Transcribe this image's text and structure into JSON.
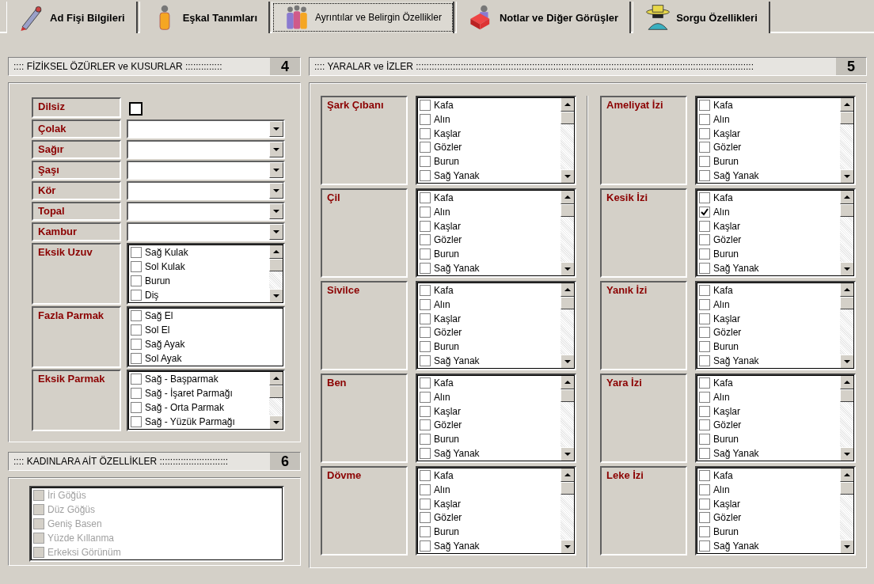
{
  "tabs": [
    {
      "label": "Ad Fişi Bilgileri",
      "selected": false
    },
    {
      "label": "Eşkal Tanımları",
      "selected": false
    },
    {
      "label": "Ayrıntılar ve Belirgin Özellikler",
      "selected": true
    },
    {
      "label": "Notlar ve Diğer Görüşler",
      "selected": false
    },
    {
      "label": "Sorgu  Özellikleri",
      "selected": false
    }
  ],
  "physical": {
    "title": ":::: FİZİKSEL ÖZÜRLER ve KUSURLAR ::::::::::::::",
    "number": "4",
    "rows": [
      {
        "label": "Dilsiz",
        "kind": "checkbox",
        "checked": false
      },
      {
        "label": "Çolak",
        "kind": "dropdown"
      },
      {
        "label": "Sağır",
        "kind": "dropdown"
      },
      {
        "label": "Şaşı",
        "kind": "dropdown"
      },
      {
        "label": "Kör",
        "kind": "dropdown"
      },
      {
        "label": "Topal",
        "kind": "dropdown"
      },
      {
        "label": "Kambur",
        "kind": "dropdown"
      },
      {
        "label": "Eksik Uzuv",
        "kind": "checklist",
        "scrollable": true,
        "items": [
          {
            "label": "Sağ Kulak",
            "checked": false
          },
          {
            "label": "Sol Kulak",
            "checked": false
          },
          {
            "label": "Burun",
            "checked": false
          },
          {
            "label": "Diş",
            "checked": false
          }
        ]
      },
      {
        "label": "Fazla Parmak",
        "kind": "checklist",
        "scrollable": false,
        "items": [
          {
            "label": "Sağ El",
            "checked": false
          },
          {
            "label": "Sol El",
            "checked": false
          },
          {
            "label": "Sağ Ayak",
            "checked": false
          },
          {
            "label": "Sol Ayak",
            "checked": false
          }
        ]
      },
      {
        "label": "Eksik Parmak",
        "kind": "checklist",
        "scrollable": true,
        "items": [
          {
            "label": "Sağ - Başparmak",
            "checked": false
          },
          {
            "label": "Sağ - İşaret Parmağı",
            "checked": false
          },
          {
            "label": "Sağ - Orta Parmak",
            "checked": false
          },
          {
            "label": "Sağ - Yüzük Parmağı",
            "checked": false
          }
        ]
      }
    ]
  },
  "women": {
    "title": ":::: KADINLARA AİT ÖZELLİKLER ::::::::::::::::::::::::::",
    "number": "6",
    "disabled": true,
    "items": [
      {
        "label": "İri Göğüs",
        "checked": false
      },
      {
        "label": "Düz Göğüs",
        "checked": false
      },
      {
        "label": "Geniş Basen",
        "checked": false
      },
      {
        "label": "Yüzde Kıllanma",
        "checked": false
      },
      {
        "label": "Erkeksi Görünüm",
        "checked": false
      }
    ]
  },
  "scars": {
    "title": ":::: YARALAR ve İZLER ::::::::::::::::::::::::::::::::::::::::::::::::::::::::::::::::::::::::::::::::::::::::::::::::::::::::::::::::::::::::::::::::",
    "number": "5",
    "columns": [
      {
        "groups": [
          {
            "label": "Şark Çıbanı",
            "items": [
              {
                "label": "Kafa",
                "checked": false
              },
              {
                "label": "Alın",
                "checked": false
              },
              {
                "label": "Kaşlar",
                "checked": false
              },
              {
                "label": "Gözler",
                "checked": false
              },
              {
                "label": "Burun",
                "checked": false
              },
              {
                "label": "Sağ Yanak",
                "checked": false
              }
            ]
          },
          {
            "label": "Çil",
            "items": [
              {
                "label": "Kafa",
                "checked": false
              },
              {
                "label": "Alın",
                "checked": false
              },
              {
                "label": "Kaşlar",
                "checked": false
              },
              {
                "label": "Gözler",
                "checked": false
              },
              {
                "label": "Burun",
                "checked": false
              },
              {
                "label": "Sağ Yanak",
                "checked": false
              }
            ]
          },
          {
            "label": "Sivilce",
            "items": [
              {
                "label": "Kafa",
                "checked": false
              },
              {
                "label": "Alın",
                "checked": false
              },
              {
                "label": "Kaşlar",
                "checked": false
              },
              {
                "label": "Gözler",
                "checked": false
              },
              {
                "label": "Burun",
                "checked": false
              },
              {
                "label": "Sağ Yanak",
                "checked": false
              }
            ]
          },
          {
            "label": "Ben",
            "items": [
              {
                "label": "Kafa",
                "checked": false
              },
              {
                "label": "Alın",
                "checked": false
              },
              {
                "label": "Kaşlar",
                "checked": false
              },
              {
                "label": "Gözler",
                "checked": false
              },
              {
                "label": "Burun",
                "checked": false
              },
              {
                "label": "Sağ Yanak",
                "checked": false
              }
            ]
          },
          {
            "label": "Dövme",
            "items": [
              {
                "label": "Kafa",
                "checked": false
              },
              {
                "label": "Alın",
                "checked": false
              },
              {
                "label": "Kaşlar",
                "checked": false
              },
              {
                "label": "Gözler",
                "checked": false
              },
              {
                "label": "Burun",
                "checked": false
              },
              {
                "label": "Sağ Yanak",
                "checked": false
              }
            ]
          }
        ]
      },
      {
        "groups": [
          {
            "label": "Ameliyat İzi",
            "items": [
              {
                "label": "Kafa",
                "checked": false
              },
              {
                "label": "Alın",
                "checked": false
              },
              {
                "label": "Kaşlar",
                "checked": false
              },
              {
                "label": "Gözler",
                "checked": false
              },
              {
                "label": "Burun",
                "checked": false
              },
              {
                "label": "Sağ Yanak",
                "checked": false
              }
            ]
          },
          {
            "label": "Kesik İzi",
            "items": [
              {
                "label": "Kafa",
                "checked": false
              },
              {
                "label": "Alın",
                "checked": true
              },
              {
                "label": "Kaşlar",
                "checked": false
              },
              {
                "label": "Gözler",
                "checked": false
              },
              {
                "label": "Burun",
                "checked": false
              },
              {
                "label": "Sağ Yanak",
                "checked": false
              }
            ]
          },
          {
            "label": "Yanık İzi",
            "items": [
              {
                "label": "Kafa",
                "checked": false
              },
              {
                "label": "Alın",
                "checked": false
              },
              {
                "label": "Kaşlar",
                "checked": false
              },
              {
                "label": "Gözler",
                "checked": false
              },
              {
                "label": "Burun",
                "checked": false
              },
              {
                "label": "Sağ Yanak",
                "checked": false
              }
            ]
          },
          {
            "label": "Yara İzi",
            "items": [
              {
                "label": "Kafa",
                "checked": false
              },
              {
                "label": "Alın",
                "checked": false
              },
              {
                "label": "Kaşlar",
                "checked": false
              },
              {
                "label": "Gözler",
                "checked": false
              },
              {
                "label": "Burun",
                "checked": false
              },
              {
                "label": "Sağ Yanak",
                "checked": false
              }
            ]
          },
          {
            "label": "Leke İzi",
            "items": [
              {
                "label": "Kafa",
                "checked": false
              },
              {
                "label": "Alın",
                "checked": false
              },
              {
                "label": "Kaşlar",
                "checked": false
              },
              {
                "label": "Gözler",
                "checked": false
              },
              {
                "label": "Burun",
                "checked": false
              },
              {
                "label": "Sağ Yanak",
                "checked": false
              }
            ]
          }
        ]
      }
    ]
  }
}
